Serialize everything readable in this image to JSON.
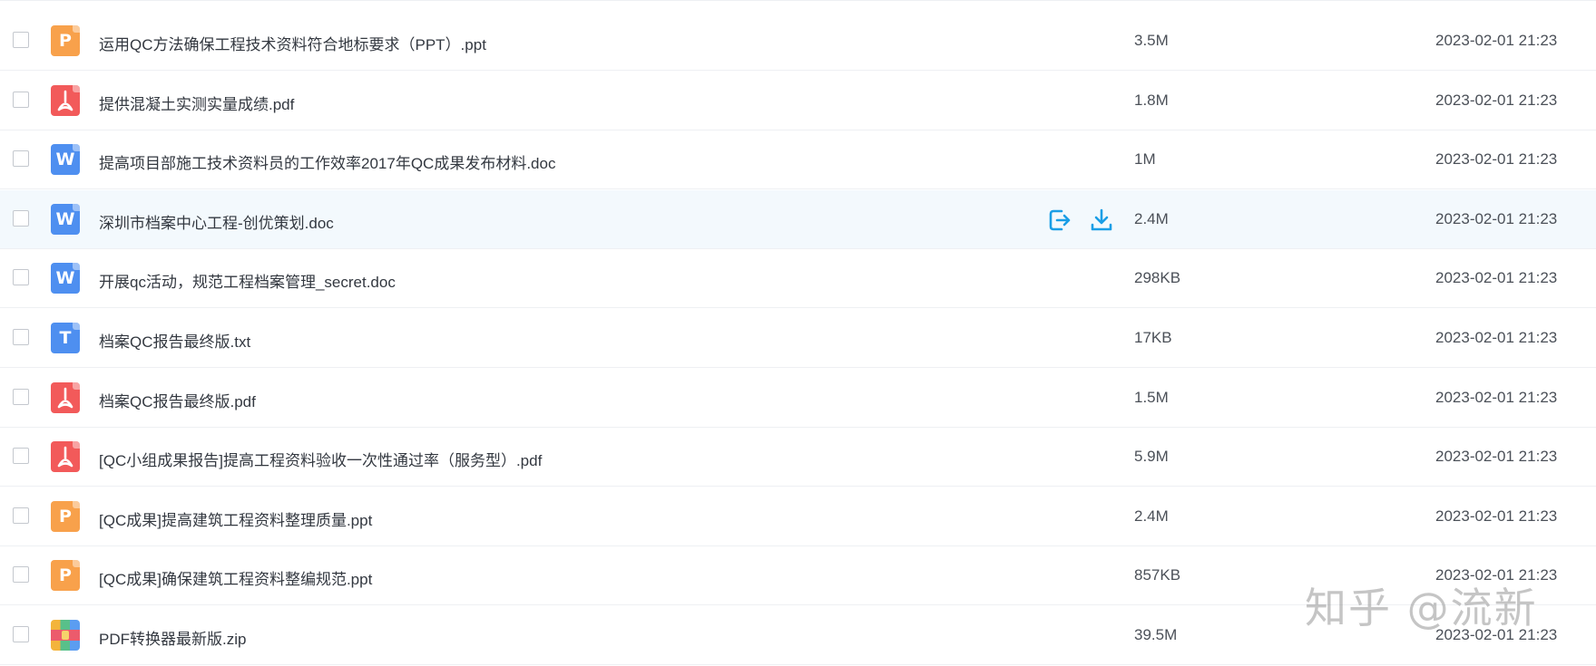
{
  "files": [
    {
      "name": "运用QC方法确保工程技术资料符合地标要求（PPT）.ppt",
      "type": "ppt",
      "icon_letter": "P",
      "size": "3.5M",
      "date": "2023-02-01 21:23"
    },
    {
      "name": "提供混凝土实测实量成绩.pdf",
      "type": "pdf",
      "icon_letter": "",
      "size": "1.8M",
      "date": "2023-02-01 21:23"
    },
    {
      "name": "提高项目部施工技术资料员的工作效率2017年QC成果发布材料.doc",
      "type": "doc",
      "icon_letter": "W",
      "size": "1M",
      "date": "2023-02-01 21:23"
    },
    {
      "name": "深圳市档案中心工程-创优策划.doc",
      "type": "doc",
      "icon_letter": "W",
      "size": "2.4M",
      "date": "2023-02-01 21:23"
    },
    {
      "name": "开展qc活动，规范工程档案管理_secret.doc",
      "type": "doc",
      "icon_letter": "W",
      "size": "298KB",
      "date": "2023-02-01 21:23"
    },
    {
      "name": "档案QC报告最终版.txt",
      "type": "txt",
      "icon_letter": "T",
      "size": "17KB",
      "date": "2023-02-01 21:23"
    },
    {
      "name": "档案QC报告最终版.pdf",
      "type": "pdf",
      "icon_letter": "",
      "size": "1.5M",
      "date": "2023-02-01 21:23"
    },
    {
      "name": "[QC小组成果报告]提高工程资料验收一次性通过率（服务型）.pdf",
      "type": "pdf",
      "icon_letter": "",
      "size": "5.9M",
      "date": "2023-02-01 21:23"
    },
    {
      "name": "[QC成果]提高建筑工程资料整理质量.ppt",
      "type": "ppt",
      "icon_letter": "P",
      "size": "2.4M",
      "date": "2023-02-01 21:23"
    },
    {
      "name": "[QC成果]确保建筑工程资料整编规范.ppt",
      "type": "ppt",
      "icon_letter": "P",
      "size": "857KB",
      "date": "2023-02-01 21:23"
    },
    {
      "name": "PDF转换器最新版.zip",
      "type": "zip",
      "icon_letter": "",
      "size": "39.5M",
      "date": "2023-02-01 21:23"
    }
  ],
  "hovered_row_index": 3,
  "row_actions": {
    "share_icon": "share-export-icon",
    "download_icon": "download-icon"
  },
  "watermark": "知乎 @流新",
  "colors": {
    "accent": "#1a9ee6",
    "hover_bg": "#f3f9fd",
    "ppt": "#f8a14b",
    "pdf": "#f25a5a",
    "doc": "#4e8ff0"
  }
}
